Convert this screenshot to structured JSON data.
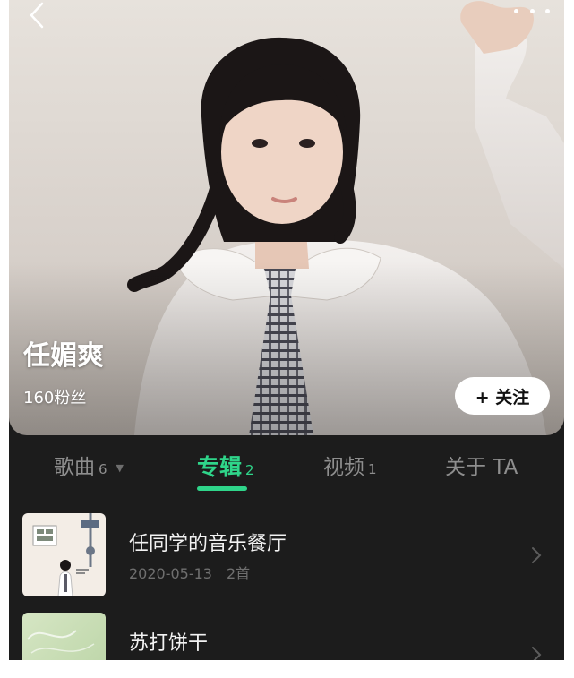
{
  "artist": {
    "name": "任媚爽",
    "fans": "160粉丝",
    "follow_label": "+ 关注"
  },
  "tabs": [
    {
      "label": "歌曲",
      "count": "6",
      "active": false
    },
    {
      "label": "专辑",
      "count": "2",
      "active": true
    },
    {
      "label": "视频",
      "count": "1",
      "active": false
    },
    {
      "label": "关于 TA",
      "count": "",
      "active": false
    }
  ],
  "albums": [
    {
      "title": "任同学的音乐餐厅",
      "date": "2020-05-13",
      "tracks": "2首"
    },
    {
      "title": "苏打饼干",
      "date": "",
      "tracks": ""
    }
  ],
  "colors": {
    "accent": "#2fd58a",
    "background": "#1c1c1c"
  },
  "icons": [
    "back-arrow-icon",
    "more-dots-icon",
    "dropdown-caret-icon",
    "chevron-right-icon"
  ]
}
